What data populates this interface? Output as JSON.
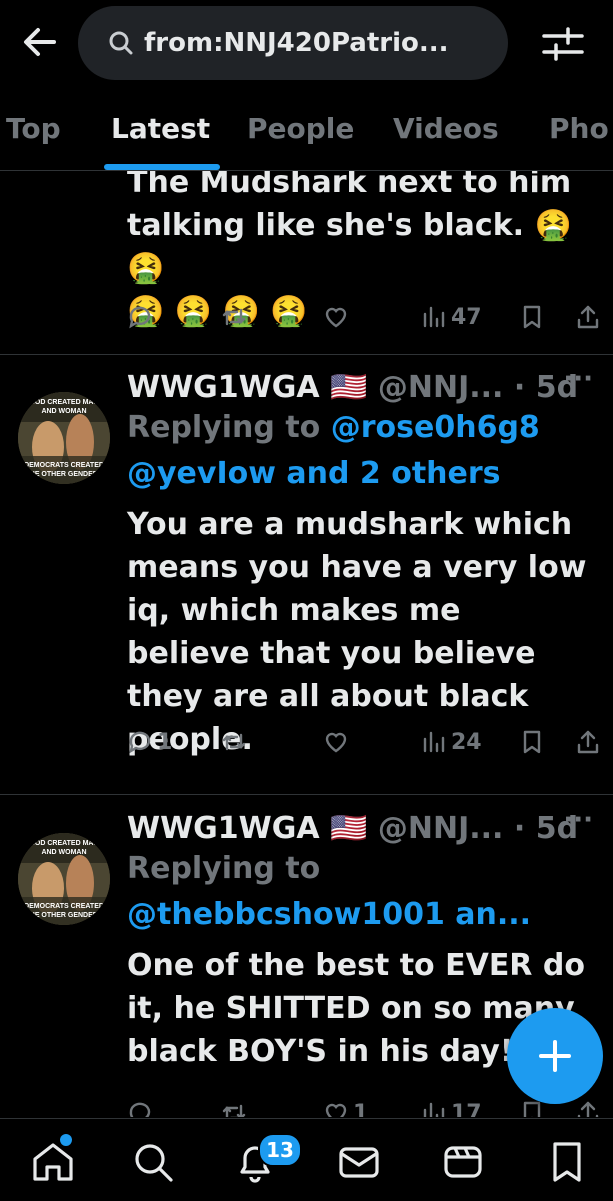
{
  "search": {
    "query": "from:NNJ420Patrio..."
  },
  "tabs": [
    {
      "label": "Top"
    },
    {
      "label": "Latest"
    },
    {
      "label": "People"
    },
    {
      "label": "Videos"
    },
    {
      "label": "Pho"
    }
  ],
  "active_tab": "Latest",
  "tweets": [
    {
      "text_lines": [
        "The Mudshark next to him",
        "talking like she's black. 🤮 🤮",
        "🤮 🤮 🤮 🤮"
      ],
      "actions": {
        "replies": "",
        "reposts": "",
        "likes": "",
        "views": "47"
      }
    },
    {
      "name": "WWG1WGA",
      "flag": "🇺🇸",
      "handle": "@NNJ...",
      "time": "· 5d",
      "more": "···",
      "avatar_text_top": "GOD CREATED MAN AND WOMAN",
      "avatar_text_bottom": "DEMOCRATS CREATED THE OTHER GENDERS",
      "replying_prefix": "Replying to",
      "replying_link1": "@rose0h6g8",
      "replying_link2": "@yevIow and 2 others",
      "text": "You are a mudshark which means you have a very low iq, which makes me believe that you believe they are all about black people.",
      "actions": {
        "replies": "1",
        "reposts": "",
        "likes": "",
        "views": "24"
      }
    },
    {
      "name": "WWG1WGA",
      "flag": "🇺🇸",
      "handle": "@NNJ...",
      "time": "· 5d",
      "more": "···",
      "avatar_text_top": "GOD CREATED MAN AND WOMAN",
      "avatar_text_bottom": "DEMOCRATS CREATED THE OTHER GENDERS",
      "replying_prefix": "Replying to",
      "replying_link1": "@thebbcshow1001 an...",
      "text": "One of the best to EVER do it, he SHITTED on so many black BOY'S in his day!",
      "actions": {
        "replies": "",
        "reposts": "",
        "likes": "1",
        "views": "17"
      }
    }
  ],
  "fab": {
    "icon": "plus-icon"
  },
  "bottom_nav": {
    "items": [
      "home-icon",
      "search-icon",
      "bell-icon",
      "mail-icon",
      "communities-icon",
      "bookmark-icon"
    ],
    "notification_count": "13"
  },
  "colors": {
    "accent": "#1d9bf0",
    "background": "#000000",
    "muted": "#71767b",
    "text": "#e7e9ea"
  }
}
